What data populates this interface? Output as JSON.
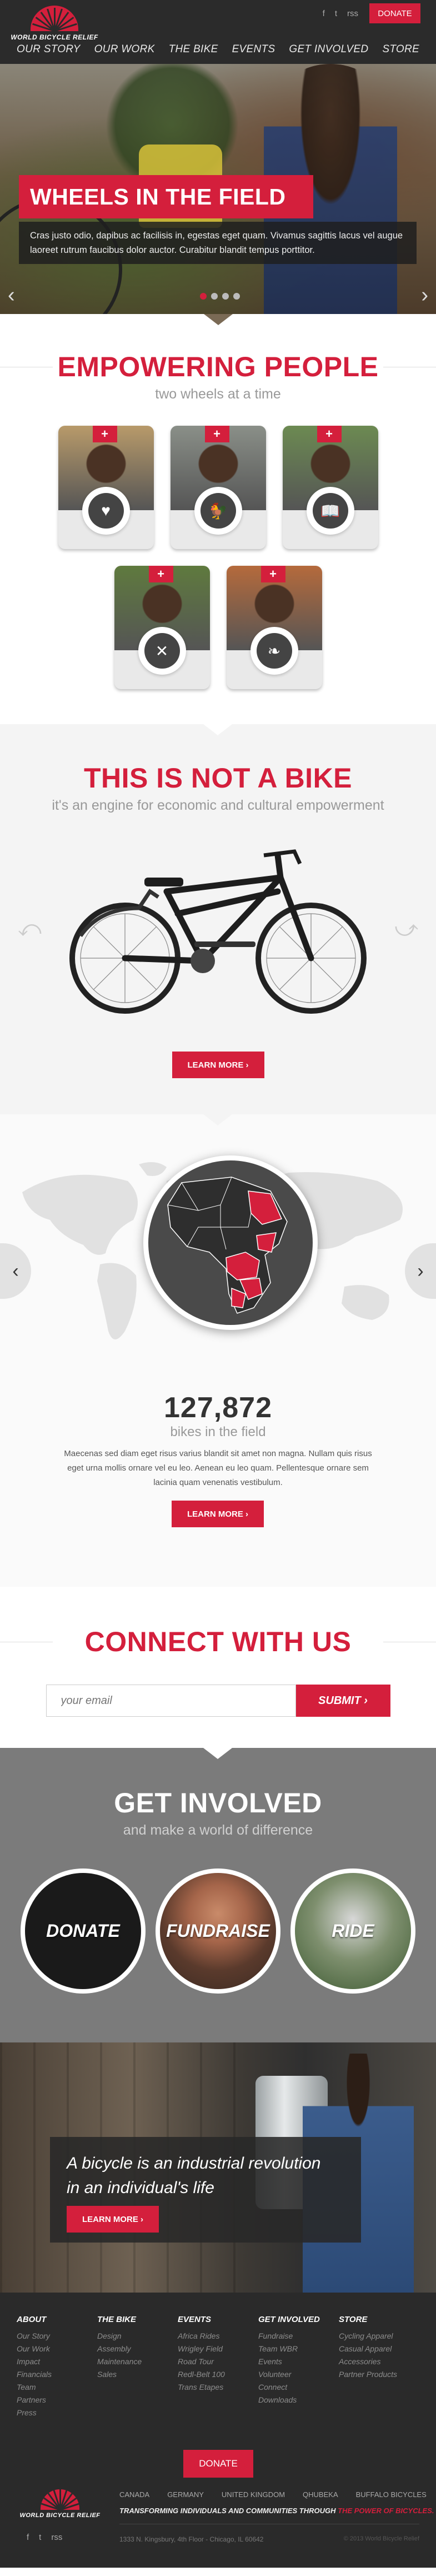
{
  "header": {
    "logo_text": "WORLD BICYCLE RELIEF",
    "social": [
      "f",
      "t",
      "rss"
    ],
    "donate_label": "DONATE",
    "nav": [
      "OUR STORY",
      "OUR WORK",
      "THE BIKE",
      "EVENTS",
      "GET INVOLVED",
      "STORE"
    ]
  },
  "hero": {
    "title": "WHEELS IN THE FIELD",
    "text": "Cras justo odio, dapibus ac facilisis in, egestas eget quam. Vivamus sagittis lacus vel augue laoreet rutrum faucibus dolor auctor. Curabitur blandit tempus porttitor.",
    "arrow_left": "‹",
    "arrow_right": "›"
  },
  "empower": {
    "title": "EMPOWERING PEOPLE",
    "subtitle": "two wheels at a time",
    "cards": [
      {
        "icon": "heart-icon",
        "glyph": "♥",
        "color": "#b89a6a"
      },
      {
        "icon": "chicken-icon",
        "glyph": "🐓",
        "color": "#8a8f88"
      },
      {
        "icon": "book-icon",
        "glyph": "📖",
        "color": "#6c8a52"
      },
      {
        "icon": "tools-icon",
        "glyph": "✕",
        "color": "#5f7a3e"
      },
      {
        "icon": "plant-icon",
        "glyph": "❧",
        "color": "#b56a3c"
      }
    ],
    "plus": "+"
  },
  "notbike": {
    "title": "THIS IS NOT A BIKE",
    "subtitle": "it's an engine for economic and cultural empowerment",
    "learn": "LEARN MORE ›"
  },
  "impact": {
    "count": "127,872",
    "count_label": "bikes in the field",
    "text": "Maecenas sed diam eget risus varius blandit sit amet non magna. Nullam quis risus eget urna mollis ornare vel eu leo. Aenean eu leo quam. Pellentesque ornare sem lacinia quam venenatis vestibulum.",
    "learn": "LEARN MORE ›",
    "arrow_left": "‹",
    "arrow_right": "›"
  },
  "connect": {
    "title": "CONNECT WITH US",
    "placeholder": "your email",
    "submit": "SUBMIT ›"
  },
  "involved": {
    "title": "GET INVOLVED",
    "subtitle": "and make a world of difference",
    "items": [
      "DONATE",
      "FUNDRAISE",
      "RIDE"
    ]
  },
  "revolution": {
    "quote_line1": "A bicycle is an industrial revolution",
    "quote_line2": "in an individual's life",
    "learn": "LEARN MORE ›"
  },
  "footer": {
    "cols": [
      {
        "title": "ABOUT",
        "items": [
          "Our Story",
          "Our Work",
          "Impact",
          "Financials",
          "Team",
          "Partners",
          "Press"
        ]
      },
      {
        "title": "THE BIKE",
        "items": [
          "Design",
          "Assembly",
          "Maintenance",
          "Sales"
        ]
      },
      {
        "title": "EVENTS",
        "items": [
          "Africa Rides",
          "Wrigley Field",
          "Road Tour",
          "Redl-Belt 100",
          "Trans Etapes"
        ]
      },
      {
        "title": "GET INVOLVED",
        "items": [
          "Fundraise",
          "Team WBR",
          "Events",
          "Volunteer",
          "Connect",
          "Downloads"
        ]
      },
      {
        "title": "STORE",
        "items": [
          "Cycling Apparel",
          "Casual Apparel",
          "Accessories",
          "Partner Products"
        ]
      }
    ],
    "donate": "DONATE",
    "countries": [
      "CANADA",
      "GERMANY",
      "UNITED KINGDOM",
      "QHUBEKA",
      "BUFFALO BICYCLES"
    ],
    "tagline": "TRANSFORMING INDIVIDUALS AND COMMUNITIES THROUGH",
    "tagline_highlight": "THE POWER OF BICYCLES.",
    "social": [
      "f",
      "t",
      "rss"
    ],
    "address": "1333 N. Kingsbury, 4th Floor - Chicago, IL 60642",
    "copyright": "© 2013 World Bicycle Relief"
  },
  "colors": {
    "accent": "#d41f3c",
    "dark": "#2b2b2b",
    "gray": "#7b7b7b"
  }
}
